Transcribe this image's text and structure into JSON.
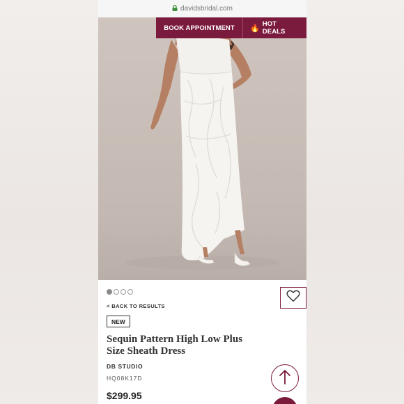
{
  "browser": {
    "url": "davidsbridal.com"
  },
  "header": {
    "book_label": "BOOK APPOINTMENT",
    "hot_label": "HOT DEALS"
  },
  "gallery": {
    "image_count": 4,
    "active_index": 0
  },
  "product": {
    "back_label": "< BACK TO RESULTS",
    "badge": "NEW",
    "title": "Sequin Pattern High Low Plus Size Sheath Dress",
    "brand": "DB STUDIO",
    "sku": "HQ08K17D",
    "price": "$299.95"
  },
  "colors": {
    "brand": "#7a1a3c",
    "secure": "#3f8f3f"
  },
  "icons": {
    "lock": "lock-icon",
    "flame": "flame-icon",
    "heart": "heart-icon",
    "arrow_up": "arrow-up-icon",
    "chat": "chat-icon"
  }
}
